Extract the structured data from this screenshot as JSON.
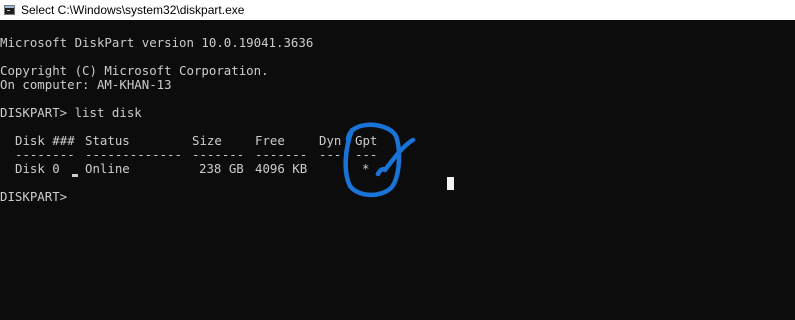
{
  "window": {
    "title": "Select C:\\Windows\\system32\\diskpart.exe",
    "icon": "console-app-icon"
  },
  "console": {
    "banner_version": "Microsoft DiskPart version 10.0.19041.3636",
    "copyright": "Copyright (C) Microsoft Corporation.",
    "computer": "On computer: AM-KHAN-13",
    "prompt_command": "DISKPART> list disk",
    "table": {
      "headers": [
        "Disk ###",
        "Status",
        "Size",
        "Free",
        "Dyn",
        "Gpt"
      ],
      "separators": [
        "--------",
        "-------------",
        "-------",
        "-------",
        "---",
        "---"
      ],
      "rows": [
        [
          "Disk 0",
          "Online",
          "238 GB",
          "4096 KB",
          "",
          "*"
        ]
      ]
    },
    "prompt_current": "DISKPART> "
  },
  "annotation": {
    "color": "#1a73d6",
    "description_icon": "hand-drawn-circle-and-check-icon"
  }
}
